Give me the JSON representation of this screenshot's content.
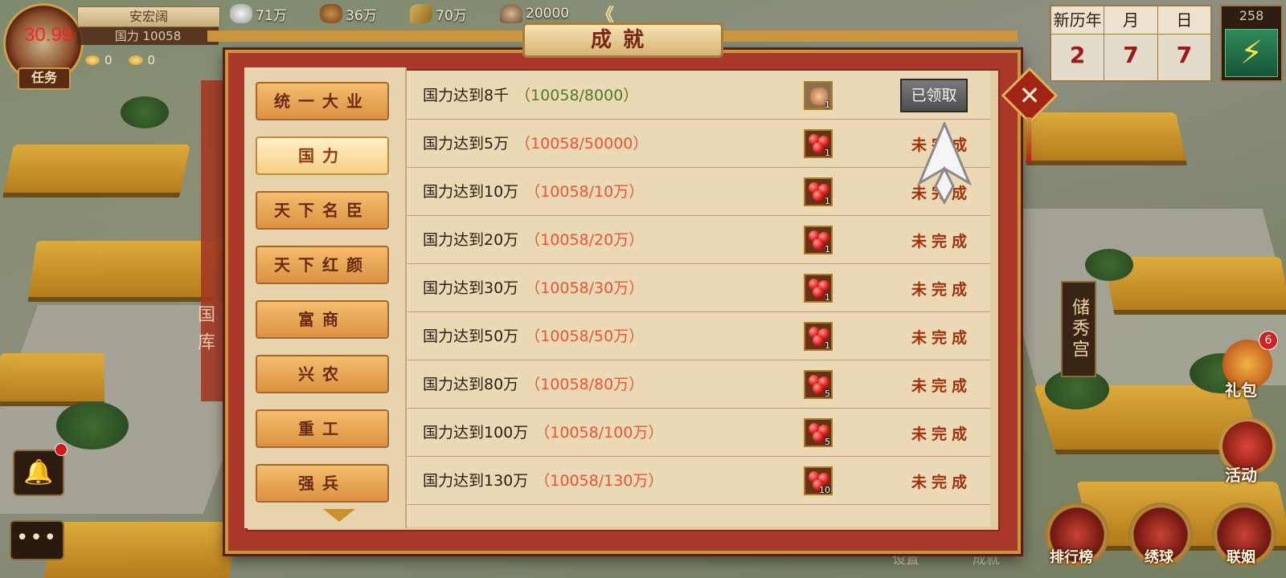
{
  "player": {
    "name": "安宏阔",
    "power_label": "国力 10058",
    "fps": "30.99",
    "gold": "0",
    "ingot": "0",
    "task_label": "任务"
  },
  "resources": [
    {
      "name": "silver",
      "value": "71万"
    },
    {
      "name": "food",
      "value": "36万"
    },
    {
      "name": "grain",
      "value": "70万"
    },
    {
      "name": "troops",
      "value": "20000"
    }
  ],
  "resource_collapse": "《",
  "calendar": {
    "year_label": "新历年",
    "year": "2",
    "month_label": "月",
    "month": "7",
    "day_label": "日",
    "day": "7"
  },
  "energy": {
    "value": "258",
    "icon": "lightning-icon"
  },
  "dialog": {
    "title": "成就",
    "close_icon": "close-icon",
    "categories": [
      {
        "label": "统一大业",
        "active": false
      },
      {
        "label": "国力",
        "active": true
      },
      {
        "label": "天下名臣",
        "active": false
      },
      {
        "label": "天下红颜",
        "active": false
      },
      {
        "label": "富商",
        "active": false
      },
      {
        "label": "兴农",
        "active": false
      },
      {
        "label": "重工",
        "active": false
      },
      {
        "label": "强兵",
        "active": false
      }
    ],
    "achievements": [
      {
        "title": "国力达到8千",
        "progress": "（10058/8000）",
        "done": true,
        "reward_type": "scroll",
        "reward_qty": "1",
        "status": "已领取"
      },
      {
        "title": "国力达到5万",
        "progress": "（10058/50000）",
        "done": false,
        "reward_type": "gem",
        "reward_qty": "1",
        "status": "未完成"
      },
      {
        "title": "国力达到10万",
        "progress": "（10058/10万）",
        "done": false,
        "reward_type": "gem",
        "reward_qty": "1",
        "status": "未完成"
      },
      {
        "title": "国力达到20万",
        "progress": "（10058/20万）",
        "done": false,
        "reward_type": "gem",
        "reward_qty": "1",
        "status": "未完成"
      },
      {
        "title": "国力达到30万",
        "progress": "（10058/30万）",
        "done": false,
        "reward_type": "gem",
        "reward_qty": "1",
        "status": "未完成"
      },
      {
        "title": "国力达到50万",
        "progress": "（10058/50万）",
        "done": false,
        "reward_type": "gem",
        "reward_qty": "1",
        "status": "未完成"
      },
      {
        "title": "国力达到80万",
        "progress": "（10058/80万）",
        "done": false,
        "reward_type": "gem",
        "reward_qty": "5",
        "status": "未完成"
      },
      {
        "title": "国力达到100万",
        "progress": "（10058/100万）",
        "done": false,
        "reward_type": "gem",
        "reward_qty": "5",
        "status": "未完成"
      },
      {
        "title": "国力达到130万",
        "progress": "（10058/130万）",
        "done": false,
        "reward_type": "gem",
        "reward_qty": "10",
        "status": "未完成"
      }
    ]
  },
  "side_buttons": {
    "gift_label": "礼包",
    "gift_badge": "6",
    "activity_label": "活动"
  },
  "bottom_buttons": {
    "settings": "设置",
    "achievements": "成就",
    "ranking": "排行榜",
    "embroidered_ball": "绣球",
    "marriage": "联姻"
  },
  "buildings": {
    "chuxiu": "储秀宫",
    "treasury": "国库"
  },
  "chat_label": "•••",
  "bell_icon": "bell-icon"
}
